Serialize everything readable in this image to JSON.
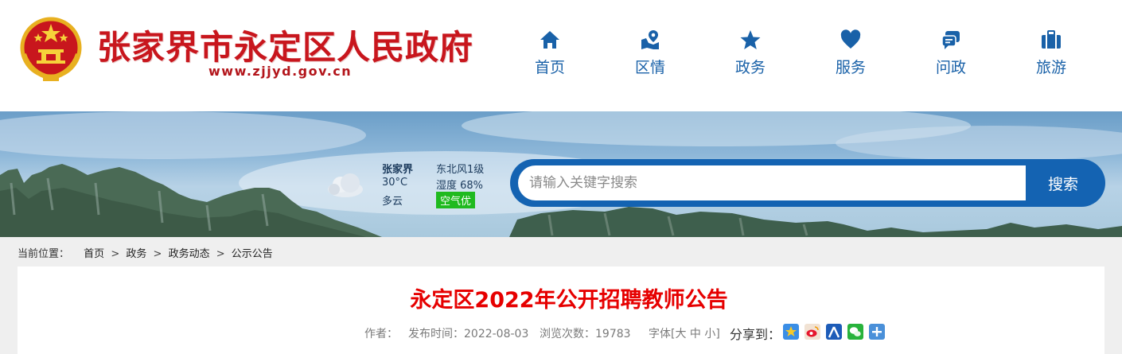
{
  "header": {
    "site_title": "张家界市永定区人民政府",
    "site_url": "www.zjjyd.gov.cn",
    "nav": [
      {
        "label": "首页",
        "icon": "home-icon"
      },
      {
        "label": "区情",
        "icon": "map-location-icon"
      },
      {
        "label": "政务",
        "icon": "star-icon"
      },
      {
        "label": "服务",
        "icon": "heart-icon"
      },
      {
        "label": "问政",
        "icon": "chat-icon"
      },
      {
        "label": "旅游",
        "icon": "briefcase-icon"
      }
    ]
  },
  "weather": {
    "city": "张家界",
    "temperature": "30°C",
    "condition": "多云",
    "wind": "东北风1级",
    "humidity": "湿度 68%",
    "air_quality": "空气优"
  },
  "search": {
    "placeholder": "请输入关键字搜索",
    "button_label": "搜索"
  },
  "breadcrumb": {
    "label": "当前位置：",
    "items": [
      "首页",
      "政务",
      "政务动态",
      "公示公告"
    ],
    "separator": ">"
  },
  "article": {
    "title": "永定区2022年公开招聘教师公告",
    "author_label": "作者：",
    "publish_label": "发布时间：2022-08-03",
    "views_label": "浏览次数：19783",
    "font_size_label": "字体[大 中 小]",
    "share_label": "分享到："
  },
  "colors": {
    "brand_red": "#c8161d",
    "title_red": "#e60000",
    "nav_blue": "#1961a8",
    "search_blue": "#1463b2",
    "air_green": "#1fba1f"
  }
}
